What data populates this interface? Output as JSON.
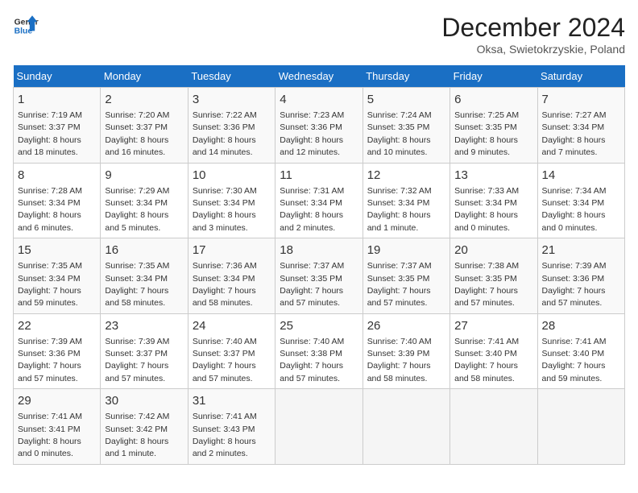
{
  "header": {
    "logo_general": "General",
    "logo_blue": "Blue",
    "month_year": "December 2024",
    "location": "Oksa, Swietokrzyskie, Poland"
  },
  "days_of_week": [
    "Sunday",
    "Monday",
    "Tuesday",
    "Wednesday",
    "Thursday",
    "Friday",
    "Saturday"
  ],
  "weeks": [
    [
      {
        "day": 1,
        "info": "Sunrise: 7:19 AM\nSunset: 3:37 PM\nDaylight: 8 hours and 18 minutes."
      },
      {
        "day": 2,
        "info": "Sunrise: 7:20 AM\nSunset: 3:37 PM\nDaylight: 8 hours and 16 minutes."
      },
      {
        "day": 3,
        "info": "Sunrise: 7:22 AM\nSunset: 3:36 PM\nDaylight: 8 hours and 14 minutes."
      },
      {
        "day": 4,
        "info": "Sunrise: 7:23 AM\nSunset: 3:36 PM\nDaylight: 8 hours and 12 minutes."
      },
      {
        "day": 5,
        "info": "Sunrise: 7:24 AM\nSunset: 3:35 PM\nDaylight: 8 hours and 10 minutes."
      },
      {
        "day": 6,
        "info": "Sunrise: 7:25 AM\nSunset: 3:35 PM\nDaylight: 8 hours and 9 minutes."
      },
      {
        "day": 7,
        "info": "Sunrise: 7:27 AM\nSunset: 3:34 PM\nDaylight: 8 hours and 7 minutes."
      }
    ],
    [
      {
        "day": 8,
        "info": "Sunrise: 7:28 AM\nSunset: 3:34 PM\nDaylight: 8 hours and 6 minutes."
      },
      {
        "day": 9,
        "info": "Sunrise: 7:29 AM\nSunset: 3:34 PM\nDaylight: 8 hours and 5 minutes."
      },
      {
        "day": 10,
        "info": "Sunrise: 7:30 AM\nSunset: 3:34 PM\nDaylight: 8 hours and 3 minutes."
      },
      {
        "day": 11,
        "info": "Sunrise: 7:31 AM\nSunset: 3:34 PM\nDaylight: 8 hours and 2 minutes."
      },
      {
        "day": 12,
        "info": "Sunrise: 7:32 AM\nSunset: 3:34 PM\nDaylight: 8 hours and 1 minute."
      },
      {
        "day": 13,
        "info": "Sunrise: 7:33 AM\nSunset: 3:34 PM\nDaylight: 8 hours and 0 minutes."
      },
      {
        "day": 14,
        "info": "Sunrise: 7:34 AM\nSunset: 3:34 PM\nDaylight: 8 hours and 0 minutes."
      }
    ],
    [
      {
        "day": 15,
        "info": "Sunrise: 7:35 AM\nSunset: 3:34 PM\nDaylight: 7 hours and 59 minutes."
      },
      {
        "day": 16,
        "info": "Sunrise: 7:35 AM\nSunset: 3:34 PM\nDaylight: 7 hours and 58 minutes."
      },
      {
        "day": 17,
        "info": "Sunrise: 7:36 AM\nSunset: 3:34 PM\nDaylight: 7 hours and 58 minutes."
      },
      {
        "day": 18,
        "info": "Sunrise: 7:37 AM\nSunset: 3:35 PM\nDaylight: 7 hours and 57 minutes."
      },
      {
        "day": 19,
        "info": "Sunrise: 7:37 AM\nSunset: 3:35 PM\nDaylight: 7 hours and 57 minutes."
      },
      {
        "day": 20,
        "info": "Sunrise: 7:38 AM\nSunset: 3:35 PM\nDaylight: 7 hours and 57 minutes."
      },
      {
        "day": 21,
        "info": "Sunrise: 7:39 AM\nSunset: 3:36 PM\nDaylight: 7 hours and 57 minutes."
      }
    ],
    [
      {
        "day": 22,
        "info": "Sunrise: 7:39 AM\nSunset: 3:36 PM\nDaylight: 7 hours and 57 minutes."
      },
      {
        "day": 23,
        "info": "Sunrise: 7:39 AM\nSunset: 3:37 PM\nDaylight: 7 hours and 57 minutes."
      },
      {
        "day": 24,
        "info": "Sunrise: 7:40 AM\nSunset: 3:37 PM\nDaylight: 7 hours and 57 minutes."
      },
      {
        "day": 25,
        "info": "Sunrise: 7:40 AM\nSunset: 3:38 PM\nDaylight: 7 hours and 57 minutes."
      },
      {
        "day": 26,
        "info": "Sunrise: 7:40 AM\nSunset: 3:39 PM\nDaylight: 7 hours and 58 minutes."
      },
      {
        "day": 27,
        "info": "Sunrise: 7:41 AM\nSunset: 3:40 PM\nDaylight: 7 hours and 58 minutes."
      },
      {
        "day": 28,
        "info": "Sunrise: 7:41 AM\nSunset: 3:40 PM\nDaylight: 7 hours and 59 minutes."
      }
    ],
    [
      {
        "day": 29,
        "info": "Sunrise: 7:41 AM\nSunset: 3:41 PM\nDaylight: 8 hours and 0 minutes."
      },
      {
        "day": 30,
        "info": "Sunrise: 7:42 AM\nSunset: 3:42 PM\nDaylight: 8 hours and 1 minute."
      },
      {
        "day": 31,
        "info": "Sunrise: 7:41 AM\nSunset: 3:43 PM\nDaylight: 8 hours and 2 minutes."
      },
      null,
      null,
      null,
      null
    ]
  ]
}
